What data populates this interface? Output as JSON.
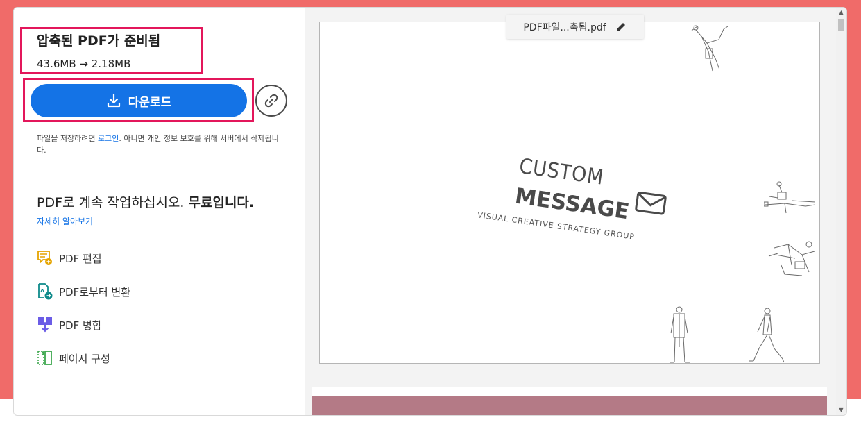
{
  "result": {
    "title": "압축된 PDF가 준비됨",
    "size_change": "43.6MB → 2.18MB"
  },
  "download": {
    "label": "다운로드"
  },
  "notice": {
    "before": "파일을 저장하려면 ",
    "login_link": "로그인",
    "after": ". 아니면 개인 정보 보호를 위해 서버에서 삭제됩니다."
  },
  "continue": {
    "text": "PDF로 계속 작업하십시오. ",
    "bold": "무료입니다.",
    "learn_more": "자세히 알아보기"
  },
  "tools": [
    {
      "label": "PDF 편집",
      "icon": "edit-pdf-icon",
      "color": "#e5a400"
    },
    {
      "label": "PDF로부터 변환",
      "icon": "convert-pdf-icon",
      "color": "#0e8a8a"
    },
    {
      "label": "PDF 병합",
      "icon": "merge-pdf-icon",
      "color": "#6b5ce6"
    },
    {
      "label": "페이지 구성",
      "icon": "organize-pages-icon",
      "color": "#3da74e"
    }
  ],
  "preview": {
    "filename": "PDF파일...축됨.pdf",
    "logo": {
      "line1": "CUSTOM",
      "line2": "MESSAGE",
      "line3": "VISUAL CREATIVE STRATEGY GROUP"
    }
  },
  "colors": {
    "accent": "#1473e6",
    "highlight": "#e3165b",
    "background": "#f06b69"
  }
}
